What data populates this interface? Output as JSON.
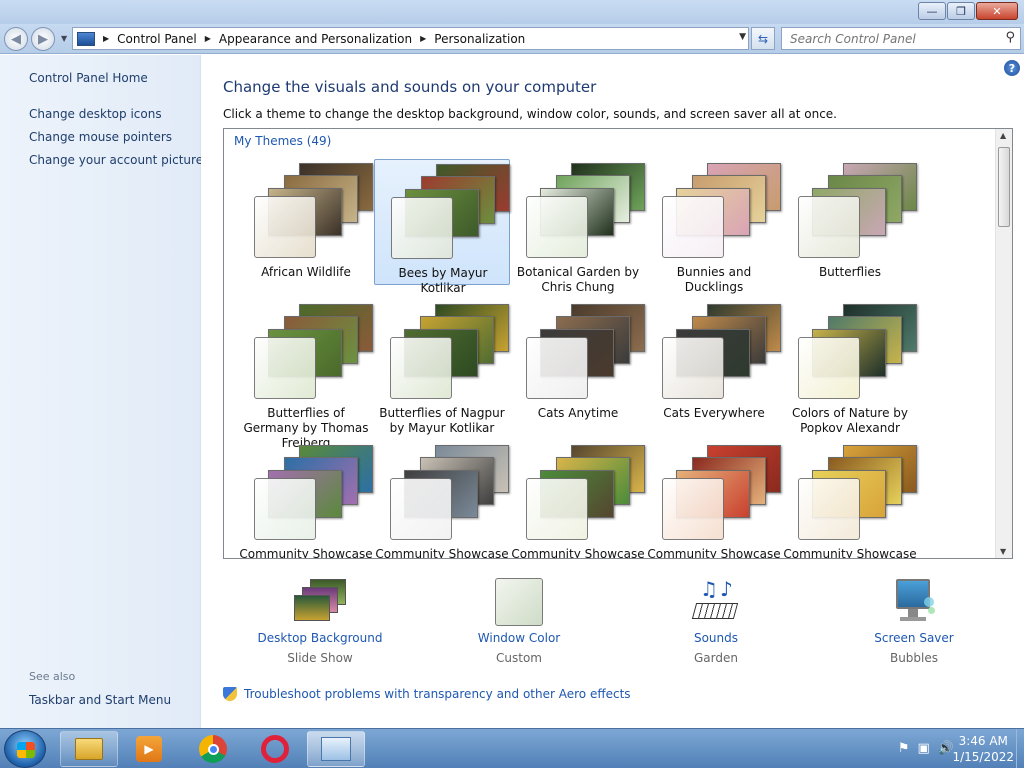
{
  "window": {
    "minimize": "—",
    "restore": "❐",
    "close": "✕"
  },
  "address": {
    "items": [
      "Control Panel",
      "Appearance and Personalization",
      "Personalization"
    ]
  },
  "search": {
    "placeholder": "Search Control Panel"
  },
  "sidebar": {
    "home": "Control Panel Home",
    "links": [
      "Change desktop icons",
      "Change mouse pointers",
      "Change your account picture"
    ],
    "see_also": "See also",
    "see_also_links": [
      "Taskbar and Start Menu"
    ]
  },
  "main": {
    "heading": "Change the visuals and sounds on your computer",
    "description": "Click a theme to change the desktop background, window color, sounds, and screen saver all at once.",
    "group_label": "My Themes (49)",
    "themes": [
      {
        "name": "African Wildlife",
        "colors": [
          "#3b3128",
          "#8a6a3f",
          "#c7b48a"
        ],
        "glass": "#e4dcc9"
      },
      {
        "name": "Bees by Mayur Kotlikar",
        "colors": [
          "#3d5a2a",
          "#9c3b2f",
          "#6b8f3e"
        ],
        "glass": "#dfe7d8"
      },
      {
        "name": "Botanical Garden by Chris Chung",
        "colors": [
          "#20301c",
          "#6ea35a",
          "#e6eee0"
        ],
        "glass": "#e2ecd9"
      },
      {
        "name": "Bunnies and Ducklings",
        "colors": [
          "#d9a3b6",
          "#c79c6e",
          "#e6d29a"
        ],
        "glass": "#f6eef5"
      },
      {
        "name": "Butterflies",
        "colors": [
          "#c9a7b5",
          "#6b8747",
          "#8fa866"
        ],
        "glass": "#e3e6d6"
      },
      {
        "name": "Butterflies of Germany by Thomas Freiberg",
        "colors": [
          "#4a6a2a",
          "#8b5a3a",
          "#6a9240"
        ],
        "glass": "#dde8cf"
      },
      {
        "name": "Butterflies of Nagpur by Mayur Kotlikar",
        "colors": [
          "#2d4a22",
          "#c7a231",
          "#516d31"
        ],
        "glass": "#dde6d1"
      },
      {
        "name": "Cats Anytime",
        "colors": [
          "#4a3a2c",
          "#8c6d4f",
          "#3b3b3b"
        ],
        "glass": "#eeeeee"
      },
      {
        "name": "Cats Everywhere",
        "colors": [
          "#2e3a2e",
          "#c08a4a",
          "#3b3b3b"
        ],
        "glass": "#e6e1d9"
      },
      {
        "name": "Colors of Nature by Popkov Alexandr",
        "colors": [
          "#1d2f2a",
          "#4f7a6a",
          "#c7b34a"
        ],
        "glass": "#f2efce"
      },
      {
        "name": "Community Showcase",
        "colors": [
          "#5a8a3a",
          "#2c6fa5",
          "#a36fb0"
        ],
        "glass": "#e6f0e6"
      },
      {
        "name": "Community Showcase",
        "colors": [
          "#7a8a99",
          "#c9c1b5",
          "#3f3f3f"
        ],
        "glass": "#f1f1f1"
      },
      {
        "name": "Community Showcase",
        "colors": [
          "#55452f",
          "#d9b44a",
          "#4b8c3a"
        ],
        "glass": "#eef1e0"
      },
      {
        "name": "Community Showcase",
        "colors": [
          "#c9402f",
          "#8a2a1f",
          "#e5b17a"
        ],
        "glass": "#f6ddcc"
      },
      {
        "name": "Community Showcase",
        "colors": [
          "#d9a33a",
          "#8a5a20",
          "#e6d15a"
        ],
        "glass": "#f3e8d6"
      }
    ]
  },
  "bottom": [
    {
      "title": "Desktop Background",
      "subtitle": "Slide Show",
      "icon": "desktop-background-icon"
    },
    {
      "title": "Window Color",
      "subtitle": "Custom",
      "icon": "window-color-icon"
    },
    {
      "title": "Sounds",
      "subtitle": "Garden",
      "icon": "sounds-icon"
    },
    {
      "title": "Screen Saver",
      "subtitle": "Bubbles",
      "icon": "screen-saver-icon"
    }
  ],
  "troubleshoot": "Troubleshoot problems with transparency and other Aero effects",
  "taskbar": {
    "time": "3:46 AM",
    "date": "1/15/2022"
  }
}
